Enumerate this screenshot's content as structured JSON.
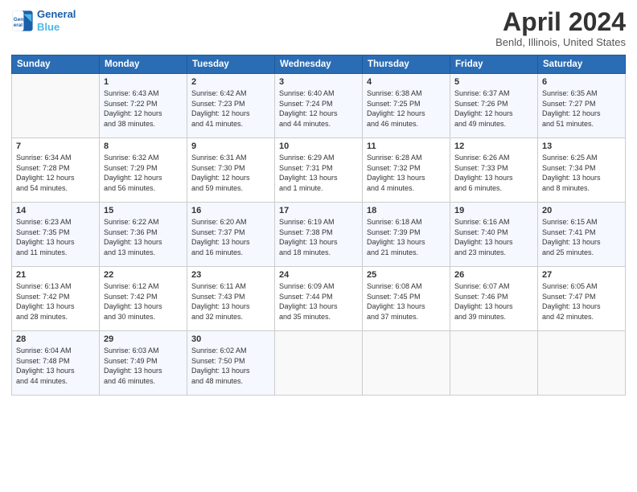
{
  "header": {
    "logo_line1": "General",
    "logo_line2": "Blue",
    "month_title": "April 2024",
    "location": "Benld, Illinois, United States"
  },
  "weekdays": [
    "Sunday",
    "Monday",
    "Tuesday",
    "Wednesday",
    "Thursday",
    "Friday",
    "Saturday"
  ],
  "rows": [
    [
      {
        "day": "",
        "info": ""
      },
      {
        "day": "1",
        "info": "Sunrise: 6:43 AM\nSunset: 7:22 PM\nDaylight: 12 hours\nand 38 minutes."
      },
      {
        "day": "2",
        "info": "Sunrise: 6:42 AM\nSunset: 7:23 PM\nDaylight: 12 hours\nand 41 minutes."
      },
      {
        "day": "3",
        "info": "Sunrise: 6:40 AM\nSunset: 7:24 PM\nDaylight: 12 hours\nand 44 minutes."
      },
      {
        "day": "4",
        "info": "Sunrise: 6:38 AM\nSunset: 7:25 PM\nDaylight: 12 hours\nand 46 minutes."
      },
      {
        "day": "5",
        "info": "Sunrise: 6:37 AM\nSunset: 7:26 PM\nDaylight: 12 hours\nand 49 minutes."
      },
      {
        "day": "6",
        "info": "Sunrise: 6:35 AM\nSunset: 7:27 PM\nDaylight: 12 hours\nand 51 minutes."
      }
    ],
    [
      {
        "day": "7",
        "info": "Sunrise: 6:34 AM\nSunset: 7:28 PM\nDaylight: 12 hours\nand 54 minutes."
      },
      {
        "day": "8",
        "info": "Sunrise: 6:32 AM\nSunset: 7:29 PM\nDaylight: 12 hours\nand 56 minutes."
      },
      {
        "day": "9",
        "info": "Sunrise: 6:31 AM\nSunset: 7:30 PM\nDaylight: 12 hours\nand 59 minutes."
      },
      {
        "day": "10",
        "info": "Sunrise: 6:29 AM\nSunset: 7:31 PM\nDaylight: 13 hours\nand 1 minute."
      },
      {
        "day": "11",
        "info": "Sunrise: 6:28 AM\nSunset: 7:32 PM\nDaylight: 13 hours\nand 4 minutes."
      },
      {
        "day": "12",
        "info": "Sunrise: 6:26 AM\nSunset: 7:33 PM\nDaylight: 13 hours\nand 6 minutes."
      },
      {
        "day": "13",
        "info": "Sunrise: 6:25 AM\nSunset: 7:34 PM\nDaylight: 13 hours\nand 8 minutes."
      }
    ],
    [
      {
        "day": "14",
        "info": "Sunrise: 6:23 AM\nSunset: 7:35 PM\nDaylight: 13 hours\nand 11 minutes."
      },
      {
        "day": "15",
        "info": "Sunrise: 6:22 AM\nSunset: 7:36 PM\nDaylight: 13 hours\nand 13 minutes."
      },
      {
        "day": "16",
        "info": "Sunrise: 6:20 AM\nSunset: 7:37 PM\nDaylight: 13 hours\nand 16 minutes."
      },
      {
        "day": "17",
        "info": "Sunrise: 6:19 AM\nSunset: 7:38 PM\nDaylight: 13 hours\nand 18 minutes."
      },
      {
        "day": "18",
        "info": "Sunrise: 6:18 AM\nSunset: 7:39 PM\nDaylight: 13 hours\nand 21 minutes."
      },
      {
        "day": "19",
        "info": "Sunrise: 6:16 AM\nSunset: 7:40 PM\nDaylight: 13 hours\nand 23 minutes."
      },
      {
        "day": "20",
        "info": "Sunrise: 6:15 AM\nSunset: 7:41 PM\nDaylight: 13 hours\nand 25 minutes."
      }
    ],
    [
      {
        "day": "21",
        "info": "Sunrise: 6:13 AM\nSunset: 7:42 PM\nDaylight: 13 hours\nand 28 minutes."
      },
      {
        "day": "22",
        "info": "Sunrise: 6:12 AM\nSunset: 7:42 PM\nDaylight: 13 hours\nand 30 minutes."
      },
      {
        "day": "23",
        "info": "Sunrise: 6:11 AM\nSunset: 7:43 PM\nDaylight: 13 hours\nand 32 minutes."
      },
      {
        "day": "24",
        "info": "Sunrise: 6:09 AM\nSunset: 7:44 PM\nDaylight: 13 hours\nand 35 minutes."
      },
      {
        "day": "25",
        "info": "Sunrise: 6:08 AM\nSunset: 7:45 PM\nDaylight: 13 hours\nand 37 minutes."
      },
      {
        "day": "26",
        "info": "Sunrise: 6:07 AM\nSunset: 7:46 PM\nDaylight: 13 hours\nand 39 minutes."
      },
      {
        "day": "27",
        "info": "Sunrise: 6:05 AM\nSunset: 7:47 PM\nDaylight: 13 hours\nand 42 minutes."
      }
    ],
    [
      {
        "day": "28",
        "info": "Sunrise: 6:04 AM\nSunset: 7:48 PM\nDaylight: 13 hours\nand 44 minutes."
      },
      {
        "day": "29",
        "info": "Sunrise: 6:03 AM\nSunset: 7:49 PM\nDaylight: 13 hours\nand 46 minutes."
      },
      {
        "day": "30",
        "info": "Sunrise: 6:02 AM\nSunset: 7:50 PM\nDaylight: 13 hours\nand 48 minutes."
      },
      {
        "day": "",
        "info": ""
      },
      {
        "day": "",
        "info": ""
      },
      {
        "day": "",
        "info": ""
      },
      {
        "day": "",
        "info": ""
      }
    ]
  ]
}
